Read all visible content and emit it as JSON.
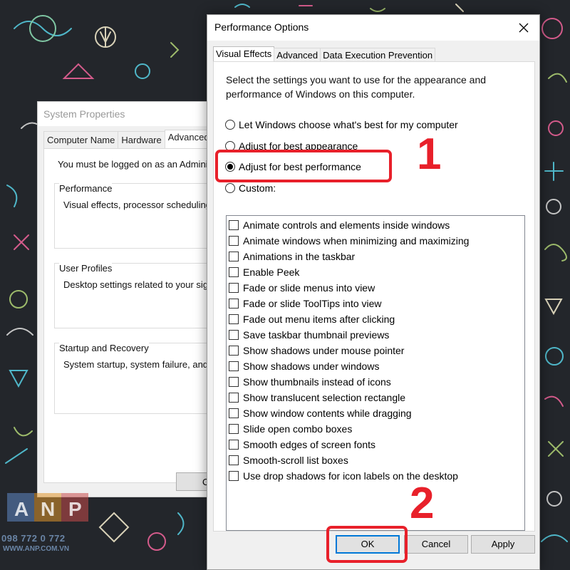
{
  "background_window": {
    "title": "System Properties",
    "tabs": [
      "Computer Name",
      "Hardware",
      "Advanced"
    ],
    "active_tab": "Advanced",
    "admin_note": "You must be logged on as an Adminis",
    "groups": [
      {
        "title": "Performance",
        "desc": "Visual effects, processor scheduling,"
      },
      {
        "title": "User Profiles",
        "desc": "Desktop settings related to your sign"
      },
      {
        "title": "Startup and Recovery",
        "desc": "System startup, system failure, and d"
      }
    ],
    "ok_label": "O"
  },
  "dialog": {
    "title": "Performance Options",
    "tabs": [
      "Visual Effects",
      "Advanced",
      "Data Execution Prevention"
    ],
    "active_tab": "Visual Effects",
    "intro": "Select the settings you want to use for the appearance and performance of Windows on this computer.",
    "radios": [
      {
        "label": "Let Windows choose what's best for my computer",
        "selected": false
      },
      {
        "label": "Adjust for best appearance",
        "selected": false
      },
      {
        "label": "Adjust for best performance",
        "selected": true
      },
      {
        "label": "Custom:",
        "selected": false
      }
    ],
    "effects": [
      {
        "label": "Animate controls and elements inside windows",
        "checked": false
      },
      {
        "label": "Animate windows when minimizing and maximizing",
        "checked": false
      },
      {
        "label": "Animations in the taskbar",
        "checked": false
      },
      {
        "label": "Enable Peek",
        "checked": false
      },
      {
        "label": "Fade or slide menus into view",
        "checked": false
      },
      {
        "label": "Fade or slide ToolTips into view",
        "checked": false
      },
      {
        "label": "Fade out menu items after clicking",
        "checked": false
      },
      {
        "label": "Save taskbar thumbnail previews",
        "checked": false
      },
      {
        "label": "Show shadows under mouse pointer",
        "checked": false
      },
      {
        "label": "Show shadows under windows",
        "checked": false
      },
      {
        "label": "Show thumbnails instead of icons",
        "checked": false
      },
      {
        "label": "Show translucent selection rectangle",
        "checked": false
      },
      {
        "label": "Show window contents while dragging",
        "checked": false
      },
      {
        "label": "Slide open combo boxes",
        "checked": false
      },
      {
        "label": "Smooth edges of screen fonts",
        "checked": false
      },
      {
        "label": "Smooth-scroll list boxes",
        "checked": false
      },
      {
        "label": "Use drop shadows for icon labels on the desktop",
        "checked": false
      }
    ],
    "buttons": {
      "ok": "OK",
      "cancel": "Cancel",
      "apply": "Apply"
    }
  },
  "annotations": {
    "step1": "1",
    "step2": "2",
    "color": "#e8202a"
  },
  "watermark": {
    "logo_letters": [
      "A",
      "N",
      "P"
    ],
    "phone": "098 772 0 772",
    "site": "WWW.ANP.COM.VN"
  },
  "colors": {
    "wallpaper": "#23262b",
    "dialog_bg": "#f0f0f0",
    "accent": "#0078d7"
  }
}
